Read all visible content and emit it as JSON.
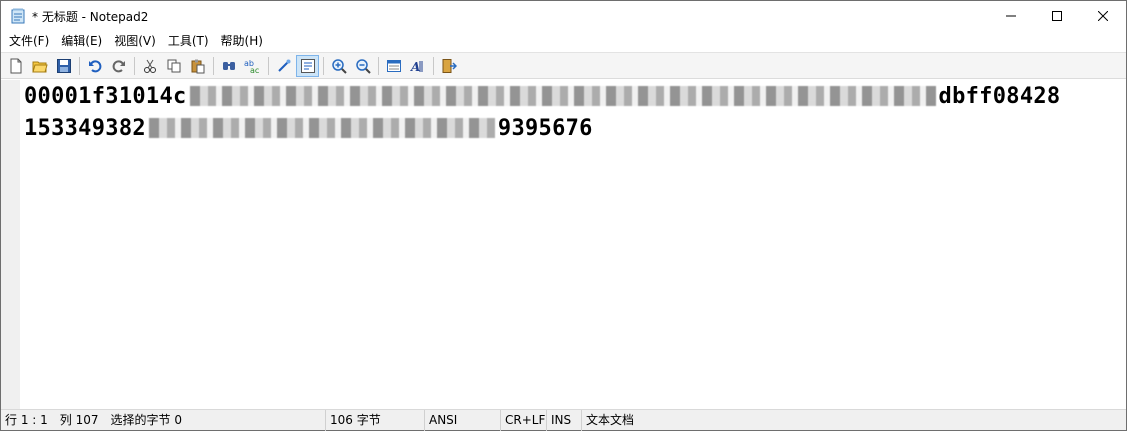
{
  "window": {
    "title": "* 无标题 - Notepad2"
  },
  "menu": {
    "items": [
      {
        "label": "文件(F)"
      },
      {
        "label": "编辑(E)"
      },
      {
        "label": "视图(V)"
      },
      {
        "label": "工具(T)"
      },
      {
        "label": "帮助(H)"
      }
    ]
  },
  "toolbar": {
    "buttons": [
      "new-file-icon",
      "open-folder-icon",
      "save-icon",
      "undo-icon",
      "redo-icon",
      "cut-icon",
      "copy-icon",
      "paste-icon",
      "find-icon",
      "replace-icon",
      "word-wrap-icon",
      "view-whitespace-icon",
      "zoom-in-icon",
      "zoom-out-icon",
      "scheme-icon",
      "font-icon",
      "exit-icon"
    ]
  },
  "editor": {
    "line1_start": "00001f31014c",
    "line1_end": "dbff08428",
    "line2_start": "153349382",
    "line2_end": "9395676"
  },
  "status": {
    "position": "行 1 : 1",
    "column": "列 107",
    "selection": "选择的字节 0",
    "bytes": "106 字节",
    "encoding": "ANSI",
    "line_ending": "CR+LF",
    "mode": "INS",
    "doc_type": "文本文档"
  },
  "colors": {
    "accent": "#cce4f7",
    "gutter": "#f0f0f0"
  }
}
